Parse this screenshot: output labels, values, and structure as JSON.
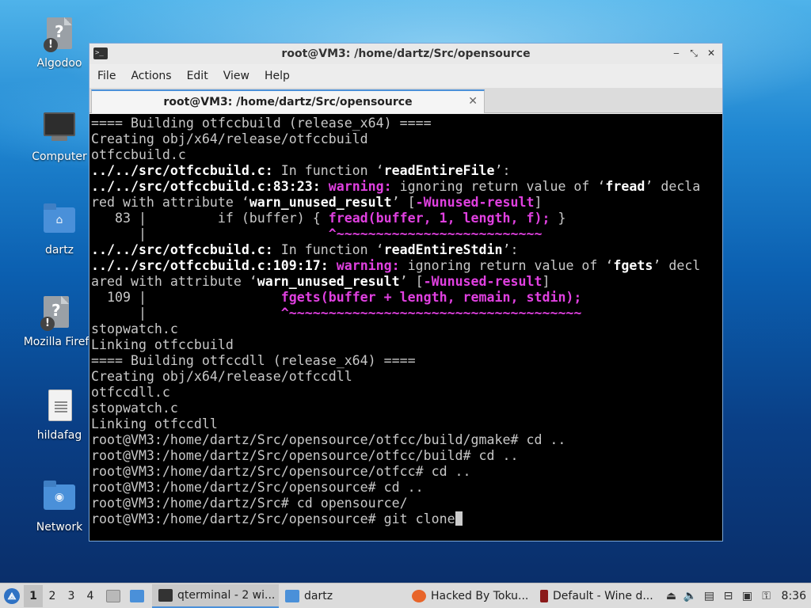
{
  "desktop": {
    "icons": [
      {
        "label": "Algodoo"
      },
      {
        "label": "Computer"
      },
      {
        "label": "dartz"
      },
      {
        "label": "Mozilla Firef"
      },
      {
        "label": "hildafag"
      },
      {
        "label": "Network"
      }
    ]
  },
  "window": {
    "title": "root@VM3: /home/dartz/Src/opensource",
    "menu": [
      "File",
      "Actions",
      "Edit",
      "View",
      "Help"
    ],
    "tab_title": "root@VM3: /home/dartz/Src/opensource"
  },
  "terminal": {
    "lines": [
      [
        {
          "t": "==== Building otfccbuild (release_x64) ===="
        }
      ],
      [
        {
          "t": "Creating obj/x64/release/otfccbuild"
        }
      ],
      [
        {
          "t": "otfccbuild.c"
        }
      ],
      [
        {
          "t": "../../src/otfccbuild.c:",
          "c": "b"
        },
        {
          "t": " In function ‘"
        },
        {
          "t": "readEntireFile",
          "c": "b"
        },
        {
          "t": "’:"
        }
      ],
      [
        {
          "t": "../../src/otfccbuild.c:83:23:",
          "c": "b"
        },
        {
          "t": " "
        },
        {
          "t": "warning:",
          "c": "w"
        },
        {
          "t": " ignoring return value of ‘"
        },
        {
          "t": "fread",
          "c": "b"
        },
        {
          "t": "’ decla"
        }
      ],
      [
        {
          "t": "red with attribute ‘"
        },
        {
          "t": "warn_unused_result",
          "c": "b"
        },
        {
          "t": "’ ["
        },
        {
          "t": "-Wunused-result",
          "c": "w"
        },
        {
          "t": "]"
        }
      ],
      [
        {
          "t": "   83 |         if (buffer) { "
        },
        {
          "t": "fread(buffer, 1, length, f);",
          "c": "w"
        },
        {
          "t": " }"
        }
      ],
      [
        {
          "t": "      |                       "
        },
        {
          "t": "^~~~~~~~~~~~~~~~~~~~~~~~~~~",
          "c": "w"
        }
      ],
      [
        {
          "t": "../../src/otfccbuild.c:",
          "c": "b"
        },
        {
          "t": " In function ‘"
        },
        {
          "t": "readEntireStdin",
          "c": "b"
        },
        {
          "t": "’:"
        }
      ],
      [
        {
          "t": "../../src/otfccbuild.c:109:17:",
          "c": "b"
        },
        {
          "t": " "
        },
        {
          "t": "warning:",
          "c": "w"
        },
        {
          "t": " ignoring return value of ‘"
        },
        {
          "t": "fgets",
          "c": "b"
        },
        {
          "t": "’ decl"
        }
      ],
      [
        {
          "t": "ared with attribute ‘"
        },
        {
          "t": "warn_unused_result",
          "c": "b"
        },
        {
          "t": "’ ["
        },
        {
          "t": "-Wunused-result",
          "c": "w"
        },
        {
          "t": "]"
        }
      ],
      [
        {
          "t": "  109 |                 "
        },
        {
          "t": "fgets(buffer + length, remain, stdin);",
          "c": "w"
        }
      ],
      [
        {
          "t": "      |                 "
        },
        {
          "t": "^~~~~~~~~~~~~~~~~~~~~~~~~~~~~~~~~~~~~~",
          "c": "w"
        }
      ],
      [
        {
          "t": "stopwatch.c"
        }
      ],
      [
        {
          "t": "Linking otfccbuild"
        }
      ],
      [
        {
          "t": "==== Building otfccdll (release_x64) ===="
        }
      ],
      [
        {
          "t": "Creating obj/x64/release/otfccdll"
        }
      ],
      [
        {
          "t": "otfccdll.c"
        }
      ],
      [
        {
          "t": "stopwatch.c"
        }
      ],
      [
        {
          "t": "Linking otfccdll"
        }
      ],
      [
        {
          "t": "root@VM3:/home/dartz/Src/opensource/otfcc/build/gmake# cd .."
        }
      ],
      [
        {
          "t": "root@VM3:/home/dartz/Src/opensource/otfcc/build# cd .."
        }
      ],
      [
        {
          "t": "root@VM3:/home/dartz/Src/opensource/otfcc# cd .."
        }
      ],
      [
        {
          "t": "root@VM3:/home/dartz/Src/opensource# cd .."
        }
      ],
      [
        {
          "t": "root@VM3:/home/dartz/Src# cd opensource/"
        }
      ],
      [
        {
          "t": "root@VM3:/home/dartz/Src/opensource# git clone"
        }
      ]
    ]
  },
  "taskbar": {
    "workspaces": [
      "1",
      "2",
      "3",
      "4"
    ],
    "tasks": [
      {
        "label": "qterminal - 2 wi...",
        "icon_color": "#333333"
      },
      {
        "label": "dartz",
        "icon_color": "#4a90d9"
      },
      {
        "label": "Hacked By Toku...",
        "icon_color": "#e8652a"
      },
      {
        "label": "Default - Wine d...",
        "icon_color": "#8b1a1a"
      }
    ],
    "clock": "8:36"
  }
}
